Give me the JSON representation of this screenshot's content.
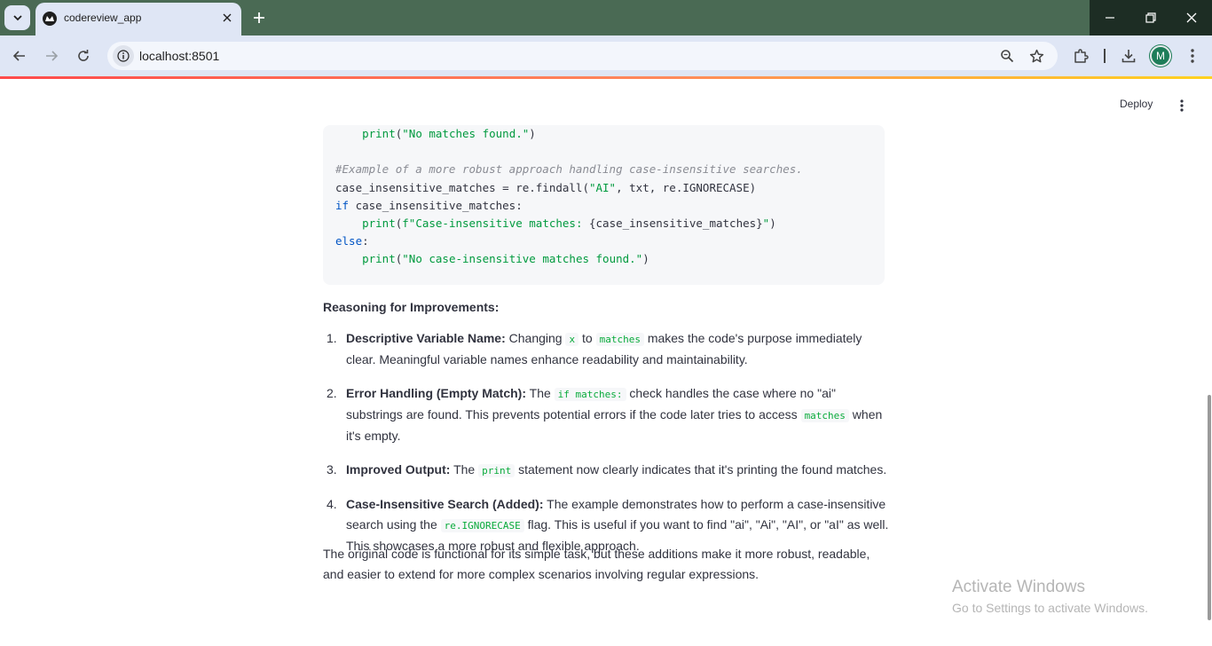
{
  "browser": {
    "tab_title": "codereview_app",
    "url": "localhost:8501",
    "avatar_letter": "M"
  },
  "app": {
    "deploy_label": "Deploy"
  },
  "code": {
    "lines": [
      [
        {
          "t": "    ",
          "c": ""
        },
        {
          "t": "print",
          "c": "c-str"
        },
        {
          "t": "(",
          "c": ""
        },
        {
          "t": "\"No matches found.\"",
          "c": "c-str"
        },
        {
          "t": ")",
          "c": ""
        }
      ],
      [],
      [
        {
          "t": "#Example of a more robust approach handling case-insensitive searches.",
          "c": "c-cm"
        }
      ],
      [
        {
          "t": "case_insensitive_matches = re.findall(",
          "c": ""
        },
        {
          "t": "\"AI\"",
          "c": "c-str"
        },
        {
          "t": ", txt, re.IGNORECASE)",
          "c": ""
        }
      ],
      [
        {
          "t": "if",
          "c": "c-kw"
        },
        {
          "t": " case_insensitive_matches:",
          "c": ""
        }
      ],
      [
        {
          "t": "    ",
          "c": ""
        },
        {
          "t": "print",
          "c": "c-str"
        },
        {
          "t": "(",
          "c": ""
        },
        {
          "t": "f\"Case-insensitive matches: ",
          "c": "c-str"
        },
        {
          "t": "{case_insensitive_matches}",
          "c": ""
        },
        {
          "t": "\"",
          "c": "c-str"
        },
        {
          "t": ")",
          "c": ""
        }
      ],
      [
        {
          "t": "else",
          "c": "c-kw"
        },
        {
          "t": ":",
          "c": ""
        }
      ],
      [
        {
          "t": "    ",
          "c": ""
        },
        {
          "t": "print",
          "c": "c-str"
        },
        {
          "t": "(",
          "c": ""
        },
        {
          "t": "\"No case-insensitive matches found.\"",
          "c": "c-str"
        },
        {
          "t": ")",
          "c": ""
        }
      ]
    ]
  },
  "reasoning": {
    "heading": "Reasoning for Improvements:",
    "items": [
      {
        "num": "1.",
        "parts": [
          {
            "t": "Descriptive Variable Name:",
            "k": "b"
          },
          {
            "t": " Changing ",
            "k": ""
          },
          {
            "t": "x",
            "k": "code"
          },
          {
            "t": " to ",
            "k": ""
          },
          {
            "t": "matches",
            "k": "code"
          },
          {
            "t": " makes the code's purpose immediately clear. Meaningful variable names enhance readability and maintainability.",
            "k": ""
          }
        ]
      },
      {
        "num": "2.",
        "parts": [
          {
            "t": "Error Handling (Empty Match):",
            "k": "b"
          },
          {
            "t": " The ",
            "k": ""
          },
          {
            "t": "if matches:",
            "k": "code"
          },
          {
            "t": " check handles the case where no \"ai\" substrings are found. This prevents potential errors if the code later tries to access ",
            "k": ""
          },
          {
            "t": "matches",
            "k": "code"
          },
          {
            "t": " when it's empty.",
            "k": ""
          }
        ]
      },
      {
        "num": "3.",
        "parts": [
          {
            "t": "Improved Output:",
            "k": "b"
          },
          {
            "t": " The ",
            "k": ""
          },
          {
            "t": "print",
            "k": "code"
          },
          {
            "t": " statement now clearly indicates that it's printing the found matches.",
            "k": ""
          }
        ]
      },
      {
        "num": "4.",
        "parts": [
          {
            "t": "Case-Insensitive Search (Added):",
            "k": "b"
          },
          {
            "t": " The example demonstrates how to perform a case-insensitive search using the ",
            "k": ""
          },
          {
            "t": "re.IGNORECASE",
            "k": "code"
          },
          {
            "t": " flag. This is useful if you want to find \"ai\", \"Ai\", \"AI\", or \"aI\" as well. This showcases a more robust and flexible approach.",
            "k": ""
          }
        ]
      }
    ],
    "conclusion": "The original code is functional for its simple task, but these additions make it more robust, readable, and easier to extend for more complex scenarios involving regular expressions."
  },
  "watermark": {
    "title": "Activate Windows",
    "subtitle": "Go to Settings to activate Windows."
  }
}
